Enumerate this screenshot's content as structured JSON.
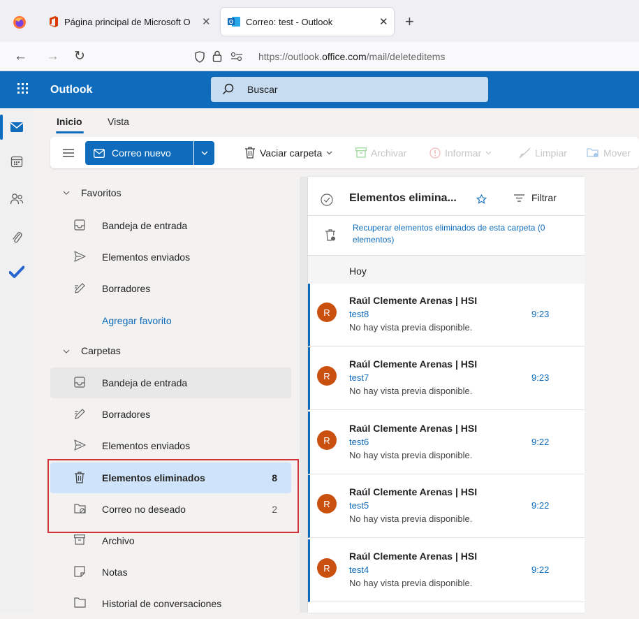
{
  "browser": {
    "tabs": [
      {
        "title": "Página principal de Microsoft O"
      },
      {
        "title": "Correo: test - Outlook"
      }
    ],
    "url_prefix": "https://outlook.",
    "url_domain": "office.com",
    "url_path": "/mail/deleteditems"
  },
  "app": {
    "name": "Outlook",
    "search_placeholder": "Buscar"
  },
  "tabs": {
    "home": "Inicio",
    "view": "Vista"
  },
  "ribbon": {
    "new_mail": "Correo nuevo",
    "empty_folder": "Vaciar carpeta",
    "archive": "Archivar",
    "report": "Informar",
    "sweep": "Limpiar",
    "move": "Mover"
  },
  "folders": {
    "favorites_label": "Favoritos",
    "favorites": [
      {
        "label": "Bandeja de entrada",
        "icon": "inbox-icon"
      },
      {
        "label": "Elementos enviados",
        "icon": "send-icon"
      },
      {
        "label": "Borradores",
        "icon": "drafts-icon"
      }
    ],
    "add_favorite": "Agregar favorito",
    "folders_label": "Carpetas",
    "items": [
      {
        "label": "Bandeja de entrada",
        "count": "",
        "icon": "inbox-icon"
      },
      {
        "label": "Borradores",
        "count": "",
        "icon": "drafts-icon"
      },
      {
        "label": "Elementos enviados",
        "count": "",
        "icon": "send-icon"
      },
      {
        "label": "Elementos eliminados",
        "count": "8",
        "icon": "trash-icon"
      },
      {
        "label": "Correo no deseado",
        "count": "2",
        "icon": "junk-icon"
      },
      {
        "label": "Archivo",
        "count": "",
        "icon": "archive-icon"
      },
      {
        "label": "Notas",
        "count": "",
        "icon": "notes-icon"
      },
      {
        "label": "Historial de conversaciones",
        "count": "",
        "icon": "folder-icon"
      }
    ]
  },
  "list": {
    "title": "Elementos elimina...",
    "filter": "Filtrar",
    "recover": "Recuperar elementos eliminados de esta carpeta (0 elementos)",
    "group_today": "Hoy",
    "messages": [
      {
        "initial": "R",
        "sender": "Raúl Clemente Arenas | HSI",
        "subject": "test8",
        "time": "9:23",
        "preview": "No hay vista previa disponible."
      },
      {
        "initial": "R",
        "sender": "Raúl Clemente Arenas | HSI",
        "subject": "test7",
        "time": "9:23",
        "preview": "No hay vista previa disponible."
      },
      {
        "initial": "R",
        "sender": "Raúl Clemente Arenas | HSI",
        "subject": "test6",
        "time": "9:22",
        "preview": "No hay vista previa disponible."
      },
      {
        "initial": "R",
        "sender": "Raúl Clemente Arenas | HSI",
        "subject": "test5",
        "time": "9:22",
        "preview": "No hay vista previa disponible."
      },
      {
        "initial": "R",
        "sender": "Raúl Clemente Arenas | HSI",
        "subject": "test4",
        "time": "9:22",
        "preview": "No hay vista previa disponible."
      }
    ]
  },
  "colors": {
    "brand": "#0f6cbd",
    "highlight_box": "#d13438",
    "avatar": "#ca5010"
  }
}
